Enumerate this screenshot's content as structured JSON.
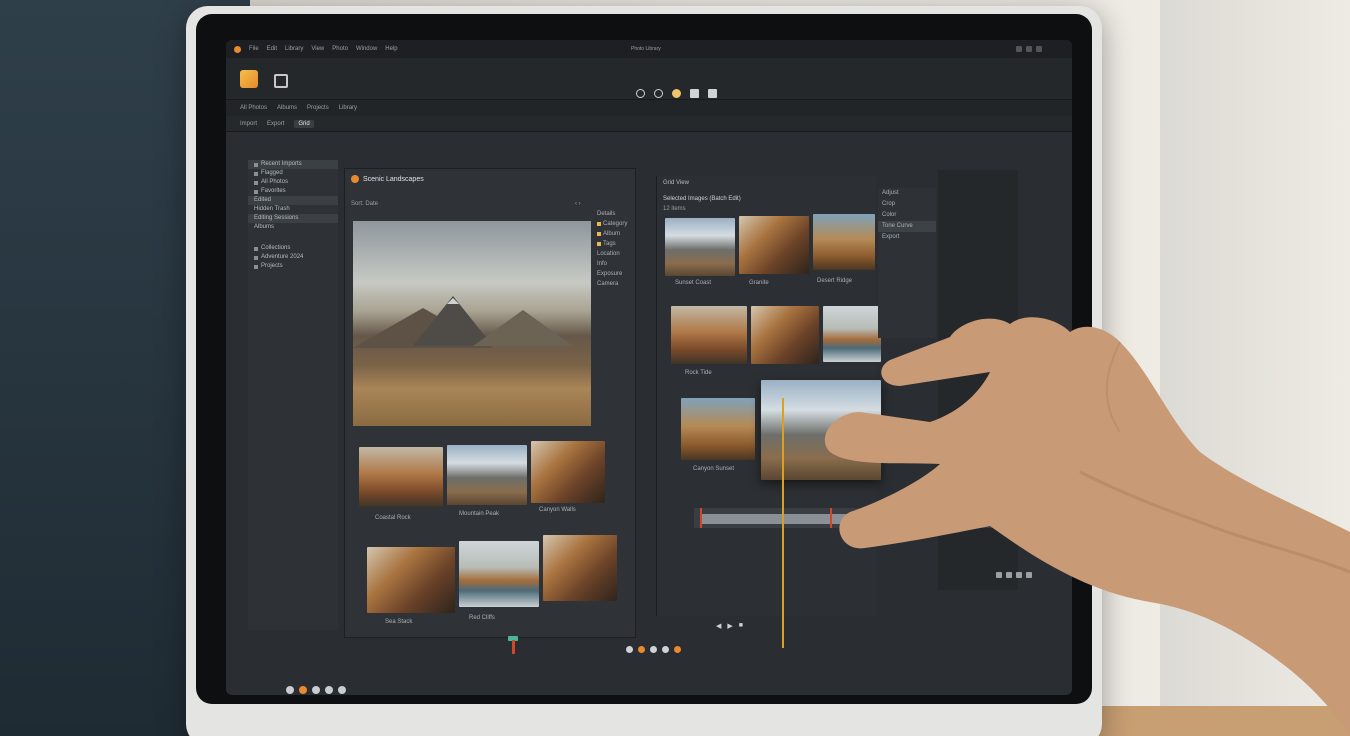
{
  "app": {
    "menu": [
      "File",
      "Edit",
      "Library",
      "View",
      "Photo",
      "Window",
      "Help"
    ],
    "window_title": "Photo Library"
  },
  "toolbar": {
    "buttons": [
      {
        "icon": "search-icon",
        "label": "Search"
      },
      {
        "icon": "filter-icon",
        "label": "Filter"
      },
      {
        "icon": "star-icon",
        "label": "Star"
      },
      {
        "icon": "folder-icon",
        "label": "Folder"
      },
      {
        "icon": "share-icon",
        "label": "Share"
      }
    ]
  },
  "subbar": {
    "items": [
      "All Photos",
      "Albums",
      "Projects",
      "Library",
      "Import",
      "Export"
    ],
    "active_tab": "Grid"
  },
  "sidebar": {
    "sections": [
      {
        "items": [
          "Recent Imports",
          "Flagged",
          "All Photos",
          "Favorites",
          "Edited",
          "Hidden Trash",
          "Editing Sessions",
          "Albums"
        ]
      },
      {
        "items": [
          "Collections",
          "Adventure 2024",
          "Projects"
        ]
      }
    ]
  },
  "center": {
    "title": "Scenic Landscapes",
    "subtitle": "Sort: Date",
    "right_column": [
      "Details",
      "Category",
      "Album",
      "Tags",
      "Location",
      "Info",
      "Exposure",
      "Camera"
    ],
    "captions": [
      "Coastal Rock",
      "Mountain Peak",
      "Canyon Walls",
      "Sea Stack",
      "Red Cliffs"
    ]
  },
  "right_panel": {
    "title": "Grid View",
    "heading": "Selected Images (Batch Edit)",
    "subheading": "12 items",
    "captions": [
      "Sunset Coast",
      "Granite",
      "Desert Ridge",
      "Rock Tide",
      "Canyon Sunset"
    ],
    "side_items": [
      "Adjust",
      "Crop",
      "Color",
      "Tone Curve",
      "Export"
    ]
  },
  "transport": {
    "labels": [
      "◀",
      "▶",
      "■"
    ]
  },
  "colors": {
    "accent": "#e98a2d",
    "playhead": "#d9a11e",
    "marker": "#d0472b"
  }
}
